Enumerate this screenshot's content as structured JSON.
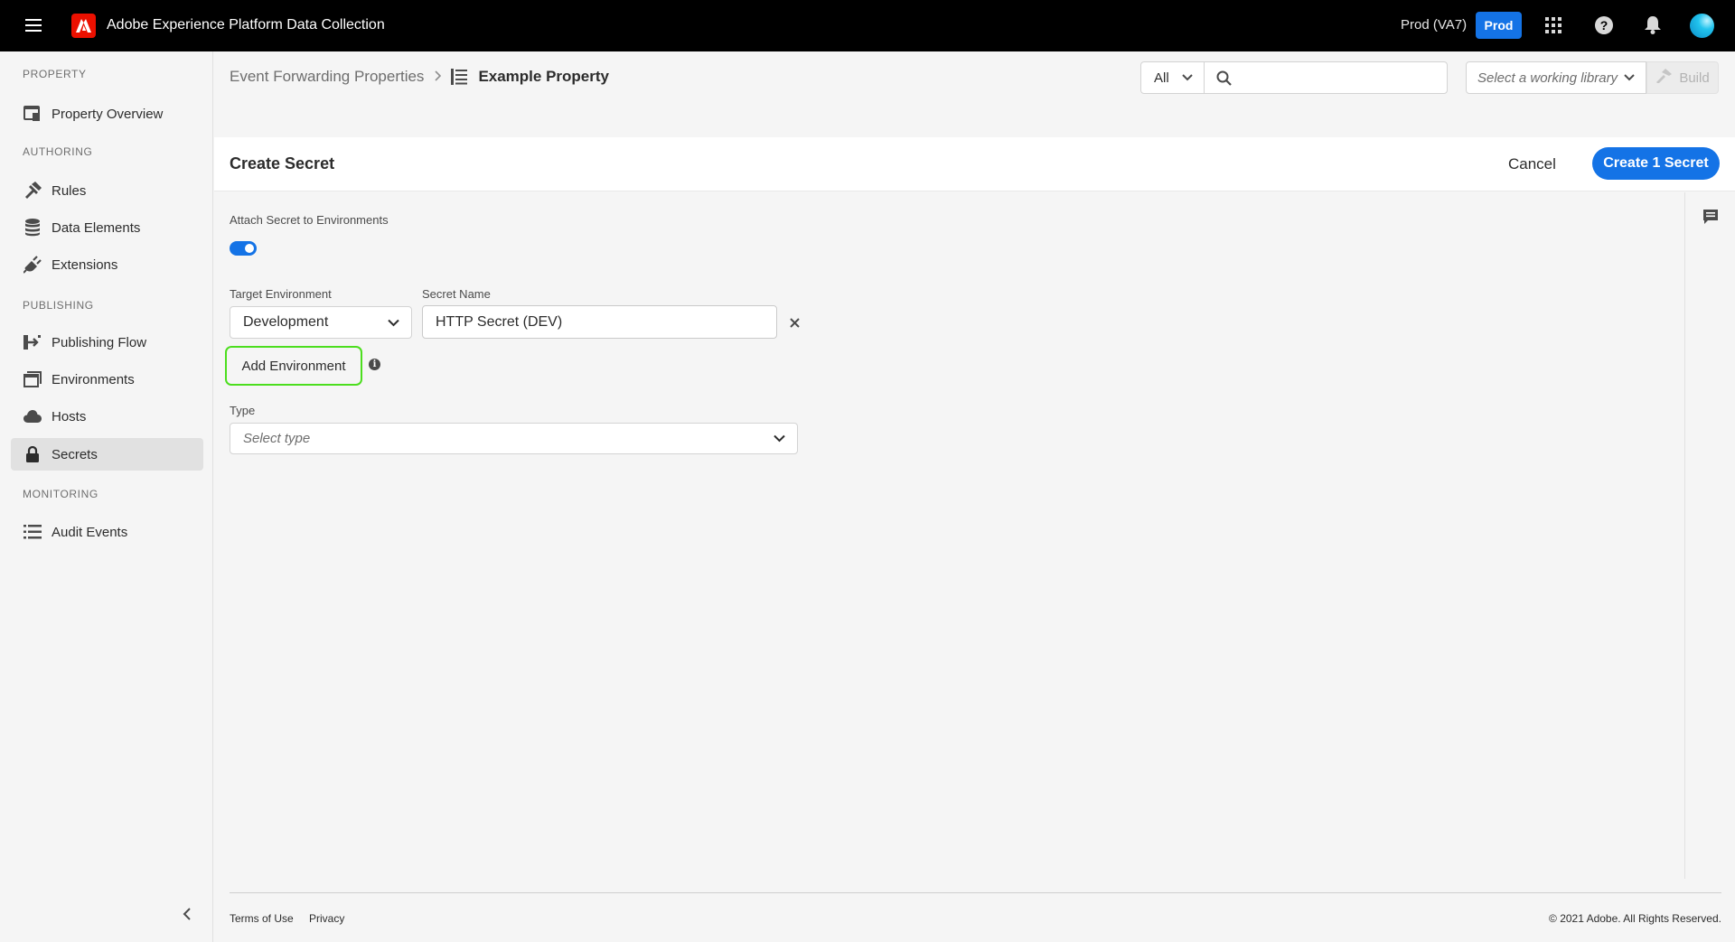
{
  "topbar": {
    "app_title": "Adobe Experience Platform Data Collection",
    "org_name": "Prod (VA7)",
    "env_badge": "Prod",
    "icons": [
      "menu-icon",
      "adobe-logo",
      "app-switcher-icon",
      "help-icon",
      "notifications-icon",
      "avatar"
    ]
  },
  "sidebar": {
    "sections": [
      {
        "title": "PROPERTY",
        "items": [
          {
            "label": "Property Overview",
            "icon": "property-overview-icon"
          }
        ]
      },
      {
        "title": "AUTHORING",
        "items": [
          {
            "label": "Rules",
            "icon": "rules-icon"
          },
          {
            "label": "Data Elements",
            "icon": "data-elements-icon"
          },
          {
            "label": "Extensions",
            "icon": "extensions-icon"
          }
        ]
      },
      {
        "title": "PUBLISHING",
        "items": [
          {
            "label": "Publishing Flow",
            "icon": "publishing-flow-icon"
          },
          {
            "label": "Environments",
            "icon": "environments-icon"
          },
          {
            "label": "Hosts",
            "icon": "cloud-icon"
          },
          {
            "label": "Secrets",
            "icon": "lock-icon",
            "active": true
          }
        ]
      },
      {
        "title": "MONITORING",
        "items": [
          {
            "label": "Audit Events",
            "icon": "list-icon"
          }
        ]
      }
    ]
  },
  "breadcrumb": {
    "parent": "Event Forwarding Properties",
    "current": "Example Property"
  },
  "toolbar": {
    "scope_value": "All",
    "search_placeholder": "",
    "library_placeholder": "Select a working library",
    "build_label": "Build"
  },
  "panel": {
    "title": "Create Secret",
    "cancel_label": "Cancel",
    "create_label": "Create 1 Secret"
  },
  "form": {
    "attach_label": "Attach Secret to Environments",
    "attach_enabled": true,
    "target_env_label": "Target Environment",
    "target_env_value": "Development",
    "secret_name_label": "Secret Name",
    "secret_name_value": "HTTP Secret (DEV)",
    "add_env_label": "Add Environment",
    "type_label": "Type",
    "type_placeholder": "Select type"
  },
  "footer": {
    "terms": "Terms of Use",
    "privacy": "Privacy",
    "copyright": "© 2021 Adobe. All Rights Reserved."
  },
  "colors": {
    "accent": "#1473e6",
    "highlight": "#4cde1e",
    "topbar": "#000000",
    "adobe_red": "#eb1000"
  }
}
